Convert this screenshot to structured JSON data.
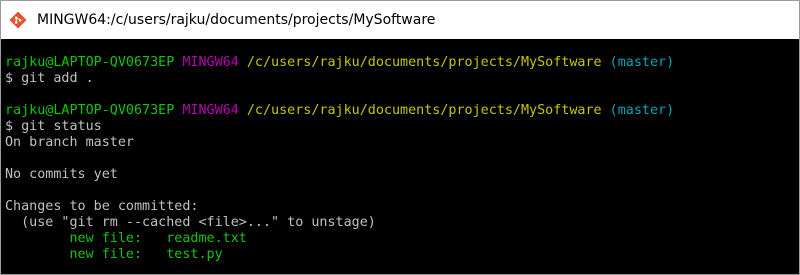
{
  "window": {
    "title": "MINGW64:/c/users/rajku/documents/projects/MySoftware",
    "icon": "git-bash-icon"
  },
  "colors": {
    "user_host": "#13c40e",
    "shell_name": "#b400b4",
    "path": "#c7c400",
    "branch": "#00a6b3",
    "text": "#c0c0c0",
    "staged_file": "#13c40e",
    "background": "#000000"
  },
  "terminal": {
    "prompt1": {
      "user_host": "rajku@LAPTOP-QV0673EP",
      "shell": "MINGW64",
      "path": "/c/users/rajku/documents/projects/MySoftware",
      "branch": "(master)",
      "command": "$ git add ."
    },
    "prompt2": {
      "user_host": "rajku@LAPTOP-QV0673EP",
      "shell": "MINGW64",
      "path": "/c/users/rajku/documents/projects/MySoftware",
      "branch": "(master)",
      "command": "$ git status"
    },
    "output": {
      "on_branch": "On branch master",
      "no_commits": "No commits yet",
      "changes_header": "Changes to be committed:",
      "unstage_hint": "  (use \"git rm --cached <file>...\" to unstage)",
      "files": [
        {
          "label": "        new file:   ",
          "name": "readme.txt"
        },
        {
          "label": "        new file:   ",
          "name": "test.py"
        }
      ]
    }
  }
}
